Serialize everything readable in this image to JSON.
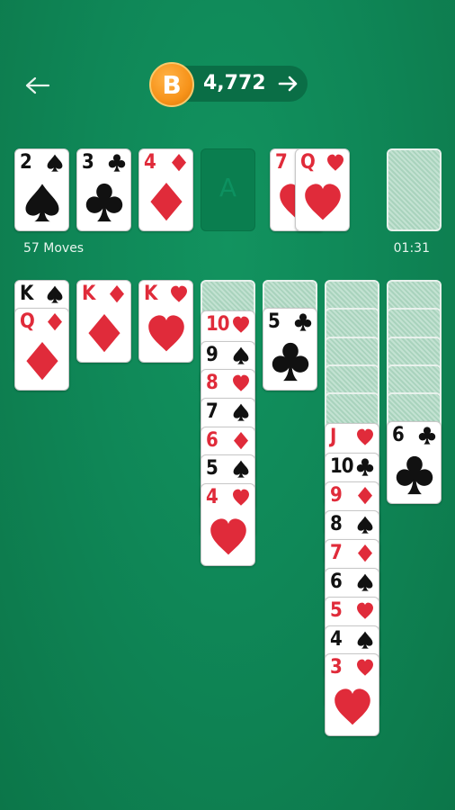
{
  "header": {
    "coin_symbol": "B",
    "coin_amount": "4,772"
  },
  "status": {
    "moves": "57 Moves",
    "timer": "01:31"
  },
  "foundation": {
    "empty_slot_label": "A"
  },
  "colors": {
    "felt": "#0f8757",
    "red_suit": "#e02b3a",
    "black_suit": "#111111",
    "coin": "#f7931a"
  },
  "cards": {
    "f1": {
      "rank": "2",
      "suit": "spade"
    },
    "f2": {
      "rank": "3",
      "suit": "club"
    },
    "f3": {
      "rank": "4",
      "suit": "diamond"
    },
    "w1": {
      "rank": "7",
      "suit": "heart"
    },
    "w2": {
      "rank": "Q",
      "suit": "heart"
    },
    "t1a": {
      "rank": "K",
      "suit": "spade"
    },
    "t1b": {
      "rank": "Q",
      "suit": "diamond"
    },
    "t2a": {
      "rank": "K",
      "suit": "diamond"
    },
    "t3a": {
      "rank": "K",
      "suit": "heart"
    },
    "t4a": {
      "rank": "10",
      "suit": "heart"
    },
    "t4b": {
      "rank": "9",
      "suit": "spade"
    },
    "t4c": {
      "rank": "8",
      "suit": "heart"
    },
    "t4d": {
      "rank": "7",
      "suit": "spade"
    },
    "t4e": {
      "rank": "6",
      "suit": "diamond"
    },
    "t4f": {
      "rank": "5",
      "suit": "spade"
    },
    "t4g": {
      "rank": "4",
      "suit": "heart"
    },
    "t5a": {
      "rank": "5",
      "suit": "club"
    },
    "t6a": {
      "rank": "J",
      "suit": "heart"
    },
    "t6b": {
      "rank": "10",
      "suit": "club"
    },
    "t6c": {
      "rank": "9",
      "suit": "diamond"
    },
    "t6d": {
      "rank": "8",
      "suit": "spade"
    },
    "t6e": {
      "rank": "7",
      "suit": "diamond"
    },
    "t6f": {
      "rank": "6",
      "suit": "spade"
    },
    "t6g": {
      "rank": "5",
      "suit": "heart"
    },
    "t6h": {
      "rank": "4",
      "suit": "spade"
    },
    "t6i": {
      "rank": "3",
      "suit": "heart"
    },
    "t7a": {
      "rank": "6",
      "suit": "club"
    }
  }
}
